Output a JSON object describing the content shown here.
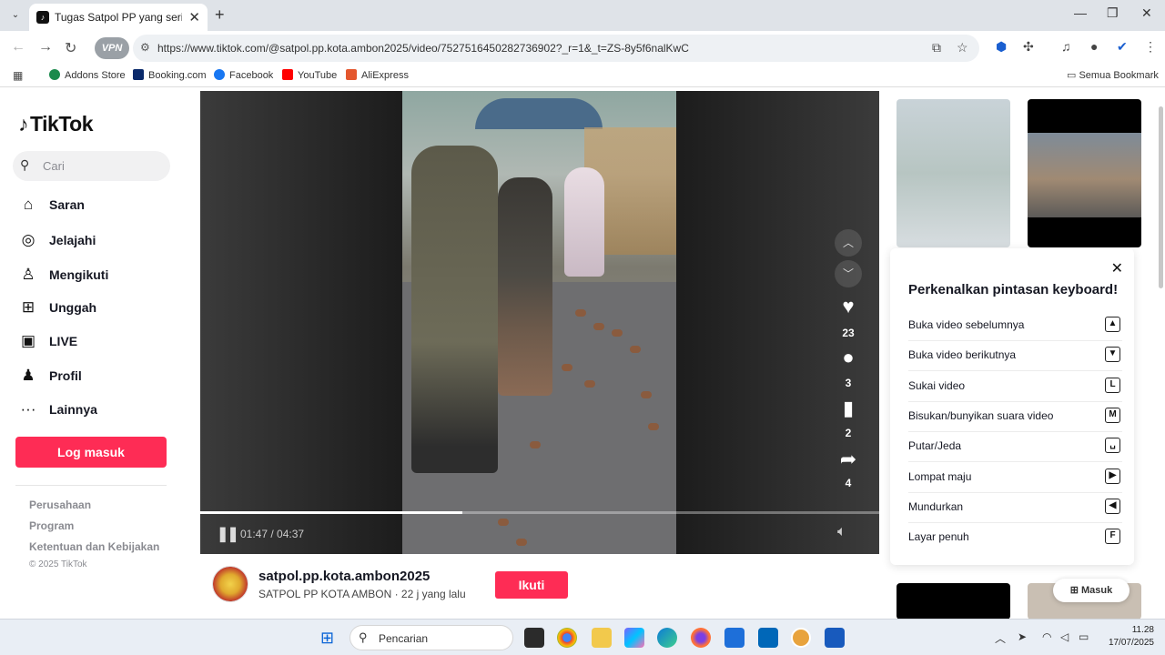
{
  "browser": {
    "tab_title": "Tugas Satpol PP yang sering be",
    "url": "https://www.tiktok.com/@satpol.pp.kota.ambon2025/video/7527516450282736902?_r=1&_t=ZS-8y5f6nalKwC",
    "vpn_label": "VPN",
    "bookmarks": [
      {
        "label": "Addons Store",
        "color": "#1a8a4c"
      },
      {
        "label": "Booking.com",
        "color": "#0a2a6b"
      },
      {
        "label": "Facebook",
        "color": "#1877f2"
      },
      {
        "label": "YouTube",
        "color": "#ff0000"
      },
      {
        "label": "AliExpress",
        "color": "#e4572e"
      }
    ],
    "all_bookmarks": "Semua Bookmark"
  },
  "sidebar": {
    "logo": "TikTok",
    "search_placeholder": "Cari",
    "nav": [
      {
        "label": "Saran",
        "icon": "home-icon"
      },
      {
        "label": "Jelajahi",
        "icon": "compass-icon"
      },
      {
        "label": "Mengikuti",
        "icon": "following-icon"
      },
      {
        "label": "Unggah",
        "icon": "upload-icon"
      },
      {
        "label": "LIVE",
        "icon": "live-icon"
      },
      {
        "label": "Profil",
        "icon": "profile-icon"
      },
      {
        "label": "Lainnya",
        "icon": "more-icon"
      }
    ],
    "login_label": "Log masuk",
    "footer": [
      "Perusahaan",
      "Program",
      "Ketentuan dan Kebijakan"
    ],
    "copyright": "© 2025 TikTok"
  },
  "player": {
    "time": "01:47 / 04:37",
    "progress": 0.386,
    "likes": "23",
    "comments": "3",
    "saves": "2",
    "shares": "4"
  },
  "author": {
    "username": "satpol.pp.kota.ambon2025",
    "subtitle": "SATPOL PP KOTA AMBON · 22 j yang lalu",
    "follow_label": "Ikuti"
  },
  "shortcuts": {
    "title": "Perkenalkan pintasan keyboard!",
    "items": [
      {
        "label": "Buka video sebelumnya",
        "key": "▲"
      },
      {
        "label": "Buka video berikutnya",
        "key": "▼"
      },
      {
        "label": "Sukai video",
        "key": "L"
      },
      {
        "label": "Bisukan/bunyikan suara video",
        "key": "M"
      },
      {
        "label": "Putar/Jeda",
        "key": "␣"
      },
      {
        "label": "Lompat maju",
        "key": "▶"
      },
      {
        "label": "Mundurkan",
        "key": "◀"
      },
      {
        "label": "Layar penuh",
        "key": "F"
      }
    ]
  },
  "masuk_label": "Masuk",
  "taskbar": {
    "search_label": "Pencarian",
    "time": "11.28",
    "date": "17/07/2025"
  },
  "colors": {
    "accent": "#fe2c55"
  }
}
